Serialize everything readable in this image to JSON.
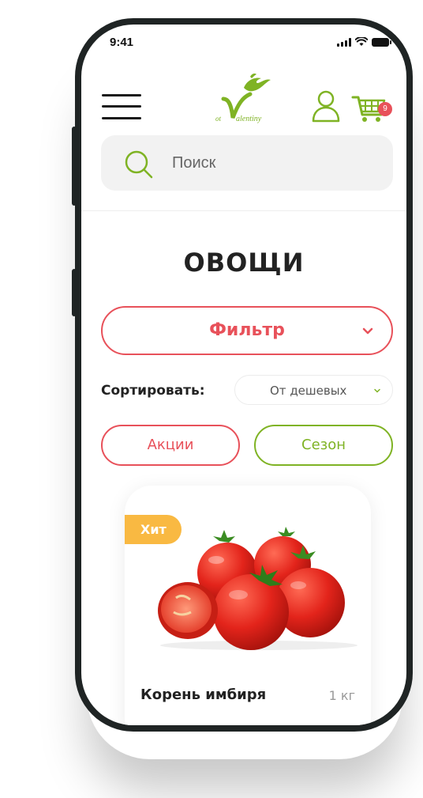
{
  "status_bar": {
    "time": "9:41"
  },
  "header": {
    "logo": {
      "text": "ot Valentiny"
    },
    "cart_count": "9",
    "icons": {
      "menu": "hamburger-menu-icon",
      "user": "user-icon",
      "cart": "cart-icon"
    }
  },
  "search": {
    "placeholder": "Поиск",
    "value": ""
  },
  "page": {
    "title": "ОВОЩИ"
  },
  "filter": {
    "label": "Фильтр"
  },
  "sort": {
    "label": "Сортировать:",
    "selected": "От дешевых"
  },
  "tags": [
    {
      "label": "Акции"
    },
    {
      "label": "Сезон"
    }
  ],
  "products": [
    {
      "badge": "Хит",
      "name": "Корень имбиря",
      "weight": "1 кг"
    }
  ],
  "colors": {
    "accent_red": "#e8515a",
    "accent_green": "#7fb324",
    "badge_orange": "#f9b942"
  }
}
